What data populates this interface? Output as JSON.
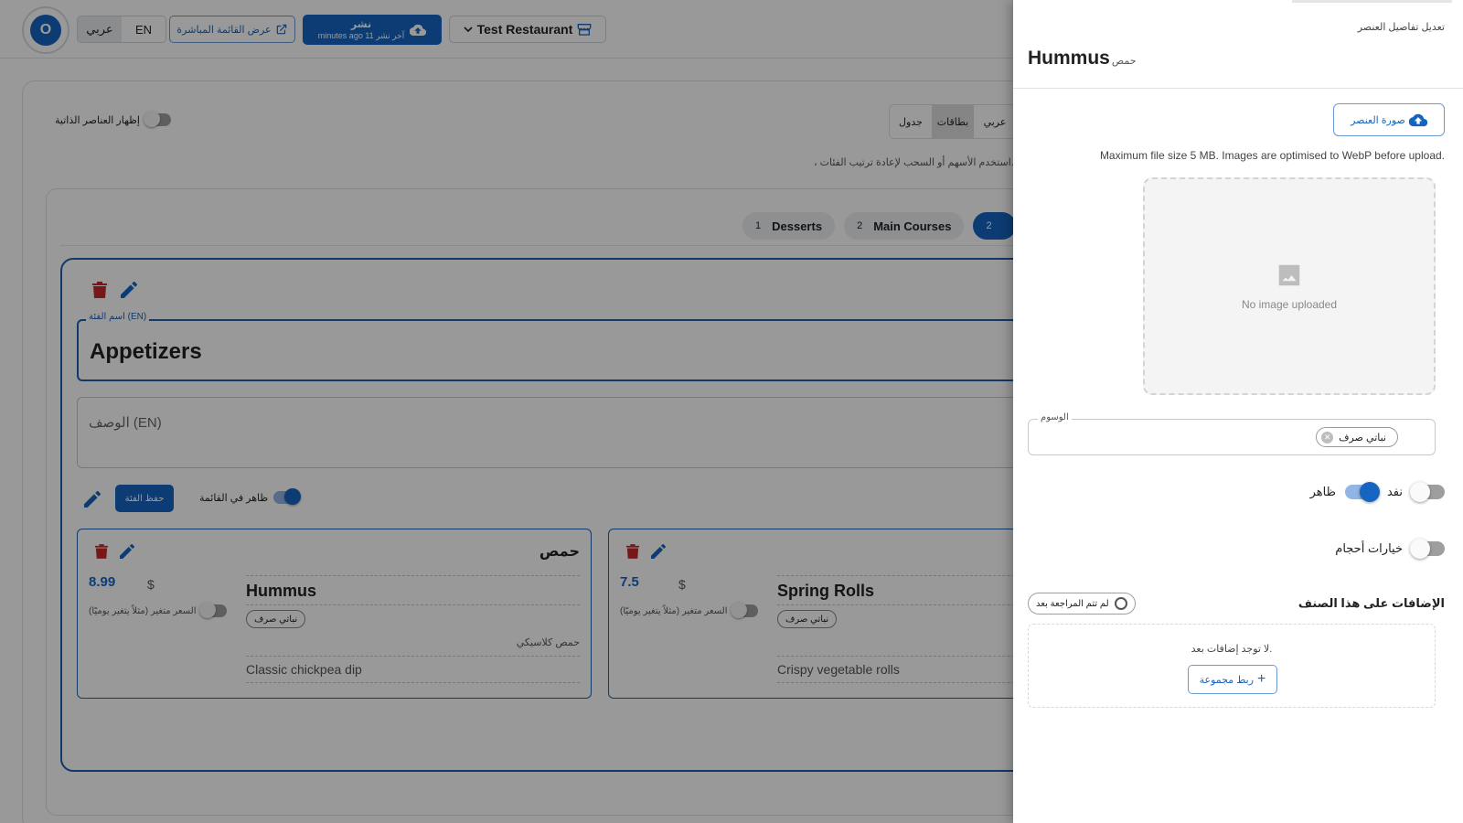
{
  "topbar": {
    "avatar_letter": "O",
    "lang_ar": "عربي",
    "lang_en": "EN",
    "live_menu_label": "عرض القائمة المباشرة",
    "publish_label": "نشر",
    "publish_sub": "minutes ago 11 آخر نشر",
    "restaurant_name": "Test Restaurant"
  },
  "toolbar": {
    "show_hidden_label": "إظهار العناصر الذاتية",
    "view_options": [
      "عربي",
      "بطاقات",
      "جدول"
    ],
    "hint": "، استخدم الأسهم أو السحب لإعادة ترتيب الفئات."
  },
  "categories": [
    {
      "num": "1",
      "label": "Desserts"
    },
    {
      "num": "2",
      "label": "Main Courses"
    },
    {
      "num": "2",
      "label": ""
    }
  ],
  "category_editor": {
    "name_label": "اسم الفئة (EN)",
    "name_value": "Appetizers",
    "desc_placeholder": "الوصف (EN)",
    "save_label": "حفظ الفئة",
    "visible_label": "ظاهر في القائمة"
  },
  "items": [
    {
      "price": "8.99",
      "currency": "$",
      "variable_price_label": "السعر متغير (مثلاً يتغير يوميًا)",
      "name_ar": "حمص",
      "name_en": "Hummus",
      "tag": "نباتي صرف",
      "desc_ar": "حمص كلاسيكي",
      "desc_en": "Classic chickpea dip"
    },
    {
      "price": "7.5",
      "currency": "$",
      "variable_price_label": "السعر متغير (مثلاً يتغير يوميًا)",
      "name_ar": "",
      "name_en": "Spring Rolls",
      "tag": "نباتي صرف",
      "desc_ar": "",
      "desc_en": "Crispy vegetable rolls"
    }
  ],
  "drawer": {
    "subtitle": "تعديل تفاصيل العنصر",
    "title_en": "Hummus",
    "title_ar": "حمص",
    "upload_label": "صورة العنصر",
    "file_note": "Maximum file size 5 MB. Images are optimised to WebP before upload.",
    "no_image": "No image uploaded",
    "tags_label": "الوسوم",
    "tag_chip": "نباتي صرف",
    "visible_label": "ظاهر",
    "sold_out_label": "نفد",
    "sizes_label": "خيارات أحجام",
    "addons_title": "الإضافات على هذا الصنف",
    "review_label": "لم تتم المراجعة بعد",
    "addons_empty": "لا توجد إضافات بعد.",
    "link_group_label": "ربط مجموعة"
  },
  "colors": {
    "accent": "#1565c0",
    "danger": "#c62828"
  }
}
